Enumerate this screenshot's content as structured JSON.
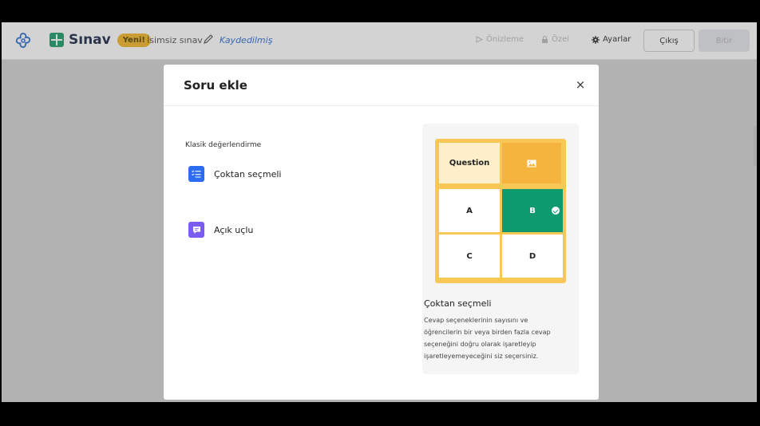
{
  "app": {
    "brand": "Sınav",
    "badge": "Yeni!",
    "quiz_name": "İsimsiz sınav",
    "status": "Kaydedilmiş"
  },
  "toolbar": {
    "preview_label": "Önizleme",
    "private_label": "Özel",
    "settings_label": "Ayarlar",
    "exit_label": "Çıkış",
    "finish_label": "Bitir"
  },
  "modal": {
    "title": "Soru ekle",
    "close_symbol": "×",
    "section_label": "Klasik değerlendirme",
    "options": [
      {
        "label": "Çoktan seçmeli",
        "icon": "checklist-icon",
        "color": "#2b6cf0"
      },
      {
        "label": "Açık uçlu",
        "icon": "speech-bubble-icon",
        "color": "#7a5cf0"
      }
    ]
  },
  "preview": {
    "cells": {
      "question": "Question",
      "a": "A",
      "b": "B",
      "c": "C",
      "d": "D"
    },
    "title": "Çoktan seçmeli",
    "description": "Cevap seçeneklerinin sayısını ve öğrencilerin bir veya birden fazla cevap seçeneğini doğru olarak işaretleyip işaretleyemeyeceğini siz seçersiniz."
  },
  "colors": {
    "accent_green": "#0e9a6f",
    "accent_yellow": "#f8c755",
    "badge_yellow": "#f2b72b",
    "link_blue": "#2f6fcf"
  }
}
